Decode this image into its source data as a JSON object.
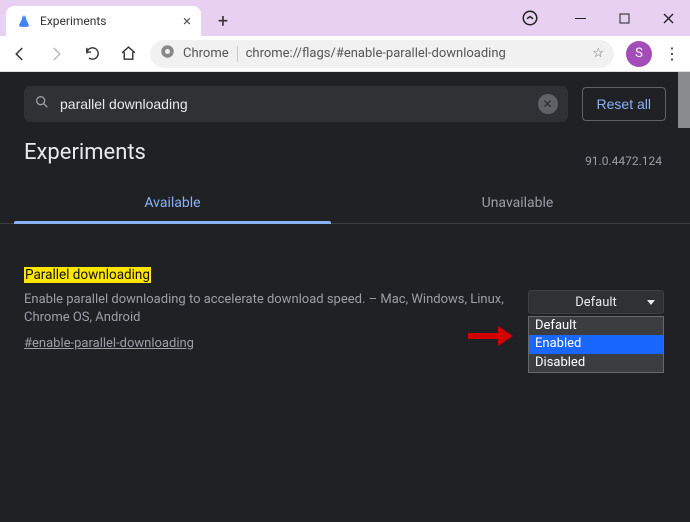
{
  "window": {
    "tab_title": "Experiments",
    "minimize": "–",
    "close": "×"
  },
  "addr": {
    "origin_label": "Chrome",
    "url": "chrome://flags/#enable-parallel-downloading"
  },
  "avatar": {
    "initial": "S"
  },
  "search": {
    "value": "parallel downloading",
    "reset_label": "Reset all"
  },
  "page": {
    "title": "Experiments",
    "version": "91.0.4472.124"
  },
  "tabs": {
    "available": "Available",
    "unavailable": "Unavailable"
  },
  "flag": {
    "title": "Parallel downloading",
    "desc": "Enable parallel downloading to accelerate download speed. – Mac, Windows, Linux, Chrome OS, Android",
    "hash": "#enable-parallel-downloading"
  },
  "dropdown": {
    "selected": "Default",
    "options": [
      "Default",
      "Enabled",
      "Disabled"
    ],
    "highlighted": "Enabled"
  }
}
